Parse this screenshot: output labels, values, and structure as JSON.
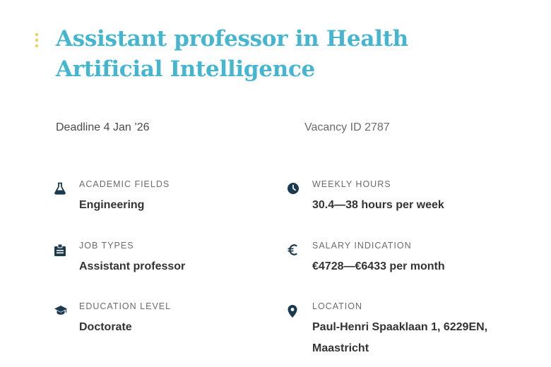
{
  "colors": {
    "title": "#45b6cf",
    "icon": "#1c3a4f",
    "accent_dots": "#e6d34a"
  },
  "title": "Assistant professor in Health Artificial Intelligence",
  "deadline": "Deadline 4 Jan ’26",
  "vacancy_id": "Vacancy ID 2787",
  "fields": {
    "academic": {
      "icon": "flask-icon",
      "label": "ACADEMIC FIELDS",
      "value": "Engineering"
    },
    "job_types": {
      "icon": "clipboard-icon",
      "label": "JOB TYPES",
      "value": "Assistant professor"
    },
    "education": {
      "icon": "graduation-cap-icon",
      "label": "EDUCATION LEVEL",
      "value": "Doctorate"
    },
    "hours": {
      "icon": "clock-icon",
      "label": "WEEKLY HOURS",
      "value": "30.4—38 hours per week"
    },
    "salary": {
      "icon": "euro-icon",
      "label": "SALARY INDICATION",
      "value": "€4728—€6433 per month"
    },
    "location": {
      "icon": "map-pin-icon",
      "label": "LOCATION",
      "value": "Paul-Henri Spaaklaan 1, 6229EN, Maastricht"
    }
  }
}
